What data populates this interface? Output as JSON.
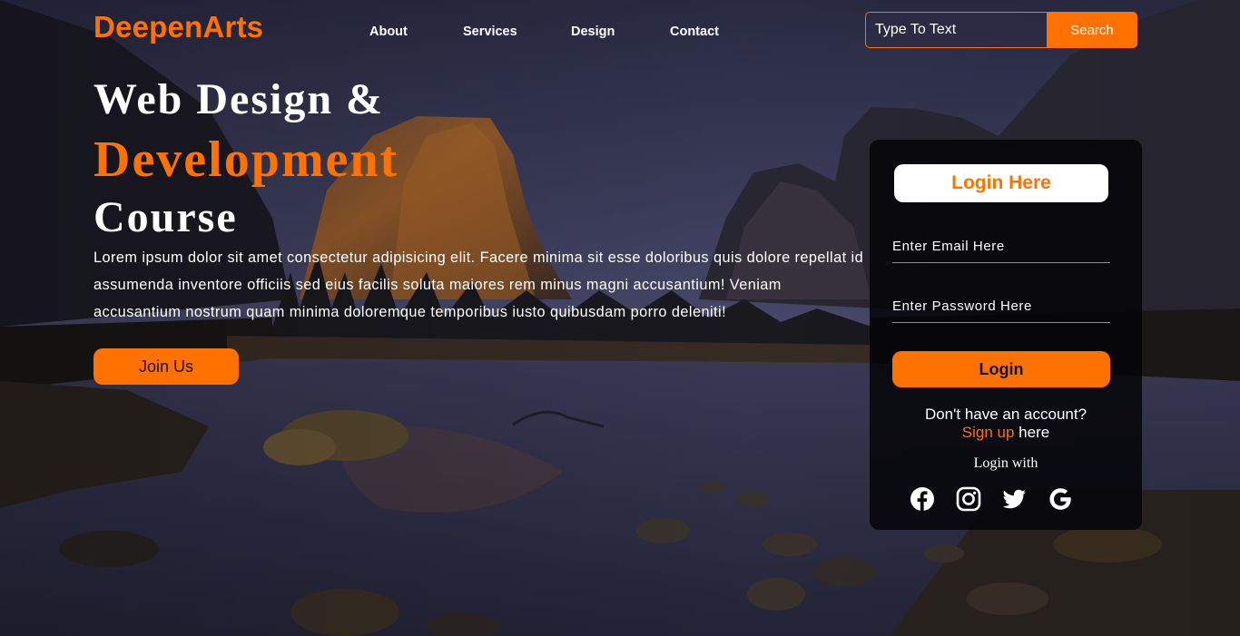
{
  "brand": {
    "logo": "DeepenArts",
    "accent": "#ff7200"
  },
  "nav": {
    "items": [
      {
        "label": "About"
      },
      {
        "label": "Services"
      },
      {
        "label": "Design"
      },
      {
        "label": "Contact"
      }
    ]
  },
  "search": {
    "placeholder": "Type To Text",
    "button_label": "Search"
  },
  "hero": {
    "title_line1": "Web Design &",
    "title_line2": "Development",
    "title_line3": "Course",
    "paragraph": "Lorem ipsum dolor sit amet consectetur adipisicing elit. Facere minima sit esse doloribus quis dolore repellat id assumenda inventore officiis sed eius facilis soluta maiores rem minus magni accusantium! Veniam accusantium nostrum quam minima doloremque temporibus iusto quibusdam porro deleniti!",
    "cta_label": "Join Us"
  },
  "login": {
    "title": "Login Here",
    "email_placeholder": "Enter Email Here",
    "password_placeholder": "Enter Password Here",
    "button_label": "Login",
    "no_account_text": "Don't have an account?",
    "signup_link": "Sign up",
    "signup_suffix": " here",
    "login_with": "Login with",
    "social_icons": [
      "facebook-icon",
      "instagram-icon",
      "twitter-icon",
      "google-icon"
    ]
  }
}
